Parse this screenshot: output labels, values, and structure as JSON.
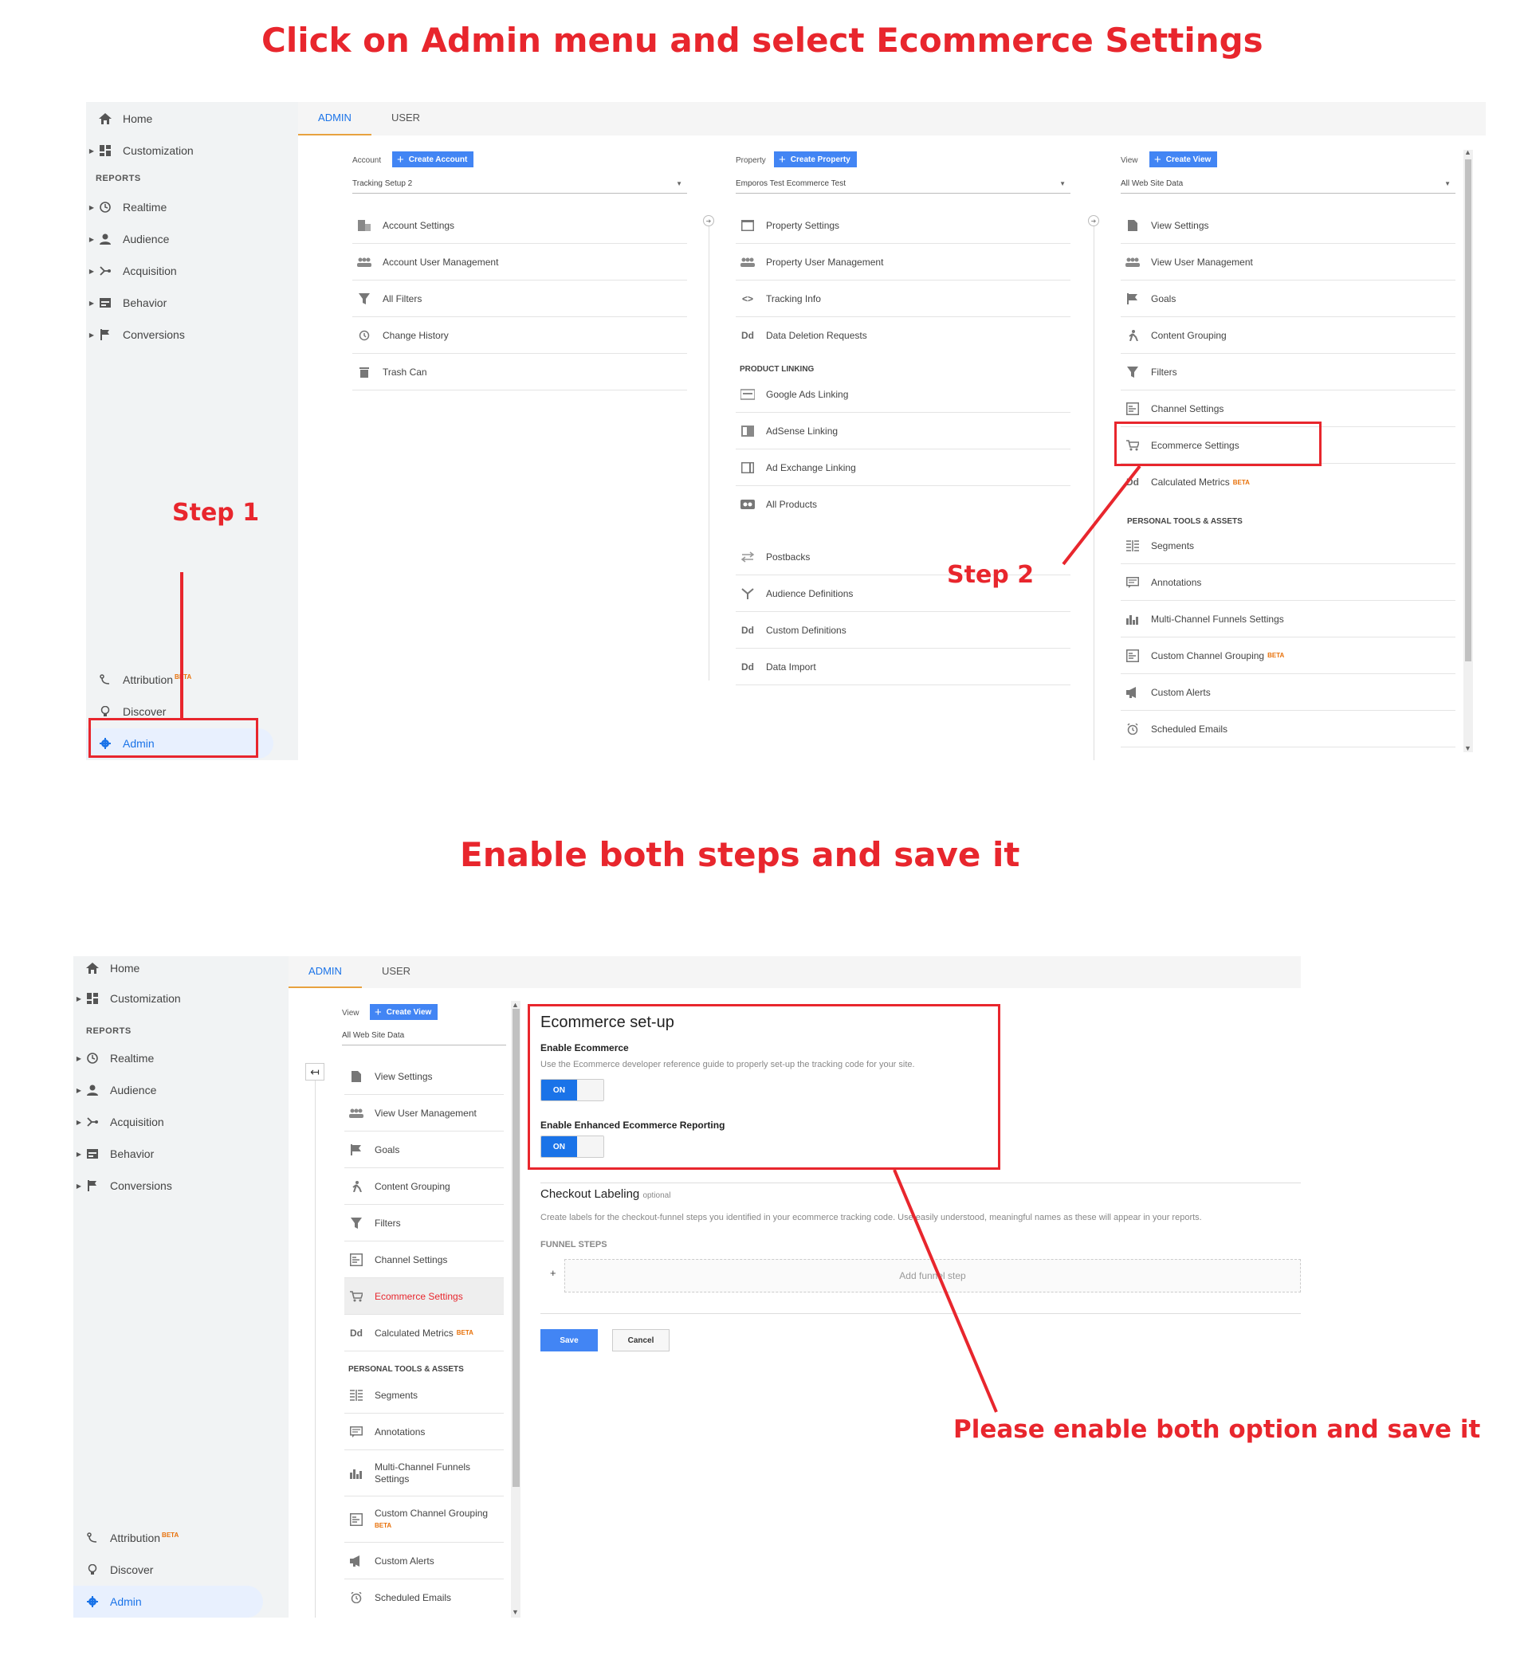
{
  "headings": {
    "top": "Click on Admin menu and select Ecommerce Settings",
    "middle": "Enable both steps and save it",
    "annotation_bottom": "Please enable both option and save it",
    "step1": "Step 1",
    "step2": "Step 2"
  },
  "sidebar": {
    "home": "Home",
    "customization": "Customization",
    "reports": "REPORTS",
    "realtime": "Realtime",
    "audience": "Audience",
    "acquisition": "Acquisition",
    "behavior": "Behavior",
    "conversions": "Conversions",
    "attribution": "Attribution",
    "beta": "BETA",
    "discover": "Discover",
    "admin": "Admin"
  },
  "tabs": {
    "admin": "ADMIN",
    "user": "USER"
  },
  "account": {
    "label": "Account",
    "create": "Create Account",
    "selected": "Tracking Setup 2",
    "items": [
      "Account Settings",
      "Account User Management",
      "All Filters",
      "Change History",
      "Trash Can"
    ]
  },
  "property": {
    "label": "Property",
    "create": "Create Property",
    "selected": "Emporos Test Ecommerce Test",
    "items": [
      "Property Settings",
      "Property User Management",
      "Tracking Info",
      "Data Deletion Requests"
    ],
    "linking_head": "PRODUCT LINKING",
    "linking": [
      "Google Ads Linking",
      "AdSense Linking",
      "Ad Exchange Linking",
      "All Products"
    ],
    "more": [
      "Postbacks",
      "Audience Definitions",
      "Custom Definitions",
      "Data Import"
    ]
  },
  "view": {
    "label": "View",
    "create": "Create View",
    "selected": "All Web Site Data",
    "items": [
      "View Settings",
      "View User Management",
      "Goals",
      "Content Grouping",
      "Filters",
      "Channel Settings",
      "Ecommerce Settings",
      "Calculated Metrics"
    ],
    "personal_head": "PERSONAL TOOLS & ASSETS",
    "personal": [
      "Segments",
      "Annotations",
      "Multi-Channel Funnels Settings",
      "Custom Channel Grouping",
      "Custom Alerts",
      "Scheduled Emails"
    ],
    "mcf_line1": "Multi-Channel Funnels",
    "mcf_line2": "Settings",
    "ccg_line1": "Custom Channel Grouping"
  },
  "ecommerce": {
    "title": "Ecommerce set-up",
    "enable_label": "Enable Ecommerce",
    "enable_help": "Use the Ecommerce developer reference guide to properly set-up the tracking code for your site.",
    "on": "ON",
    "enhanced_label": "Enable Enhanced Ecommerce Reporting",
    "checkout_title": "Checkout Labeling",
    "optional": "optional",
    "checkout_help": "Create labels for the checkout-funnel steps you identified in your ecommerce tracking code. Use easily understood, meaningful names as these will appear in your reports.",
    "funnel_head": "FUNNEL STEPS",
    "plus": "+",
    "add_step": "Add funnel step",
    "save": "Save",
    "cancel": "Cancel"
  },
  "colors": {
    "annotation_red": "#e8262d",
    "accent_blue": "#4285f4",
    "tab_underline": "#e8a23f",
    "beta_orange": "#e8710a"
  }
}
